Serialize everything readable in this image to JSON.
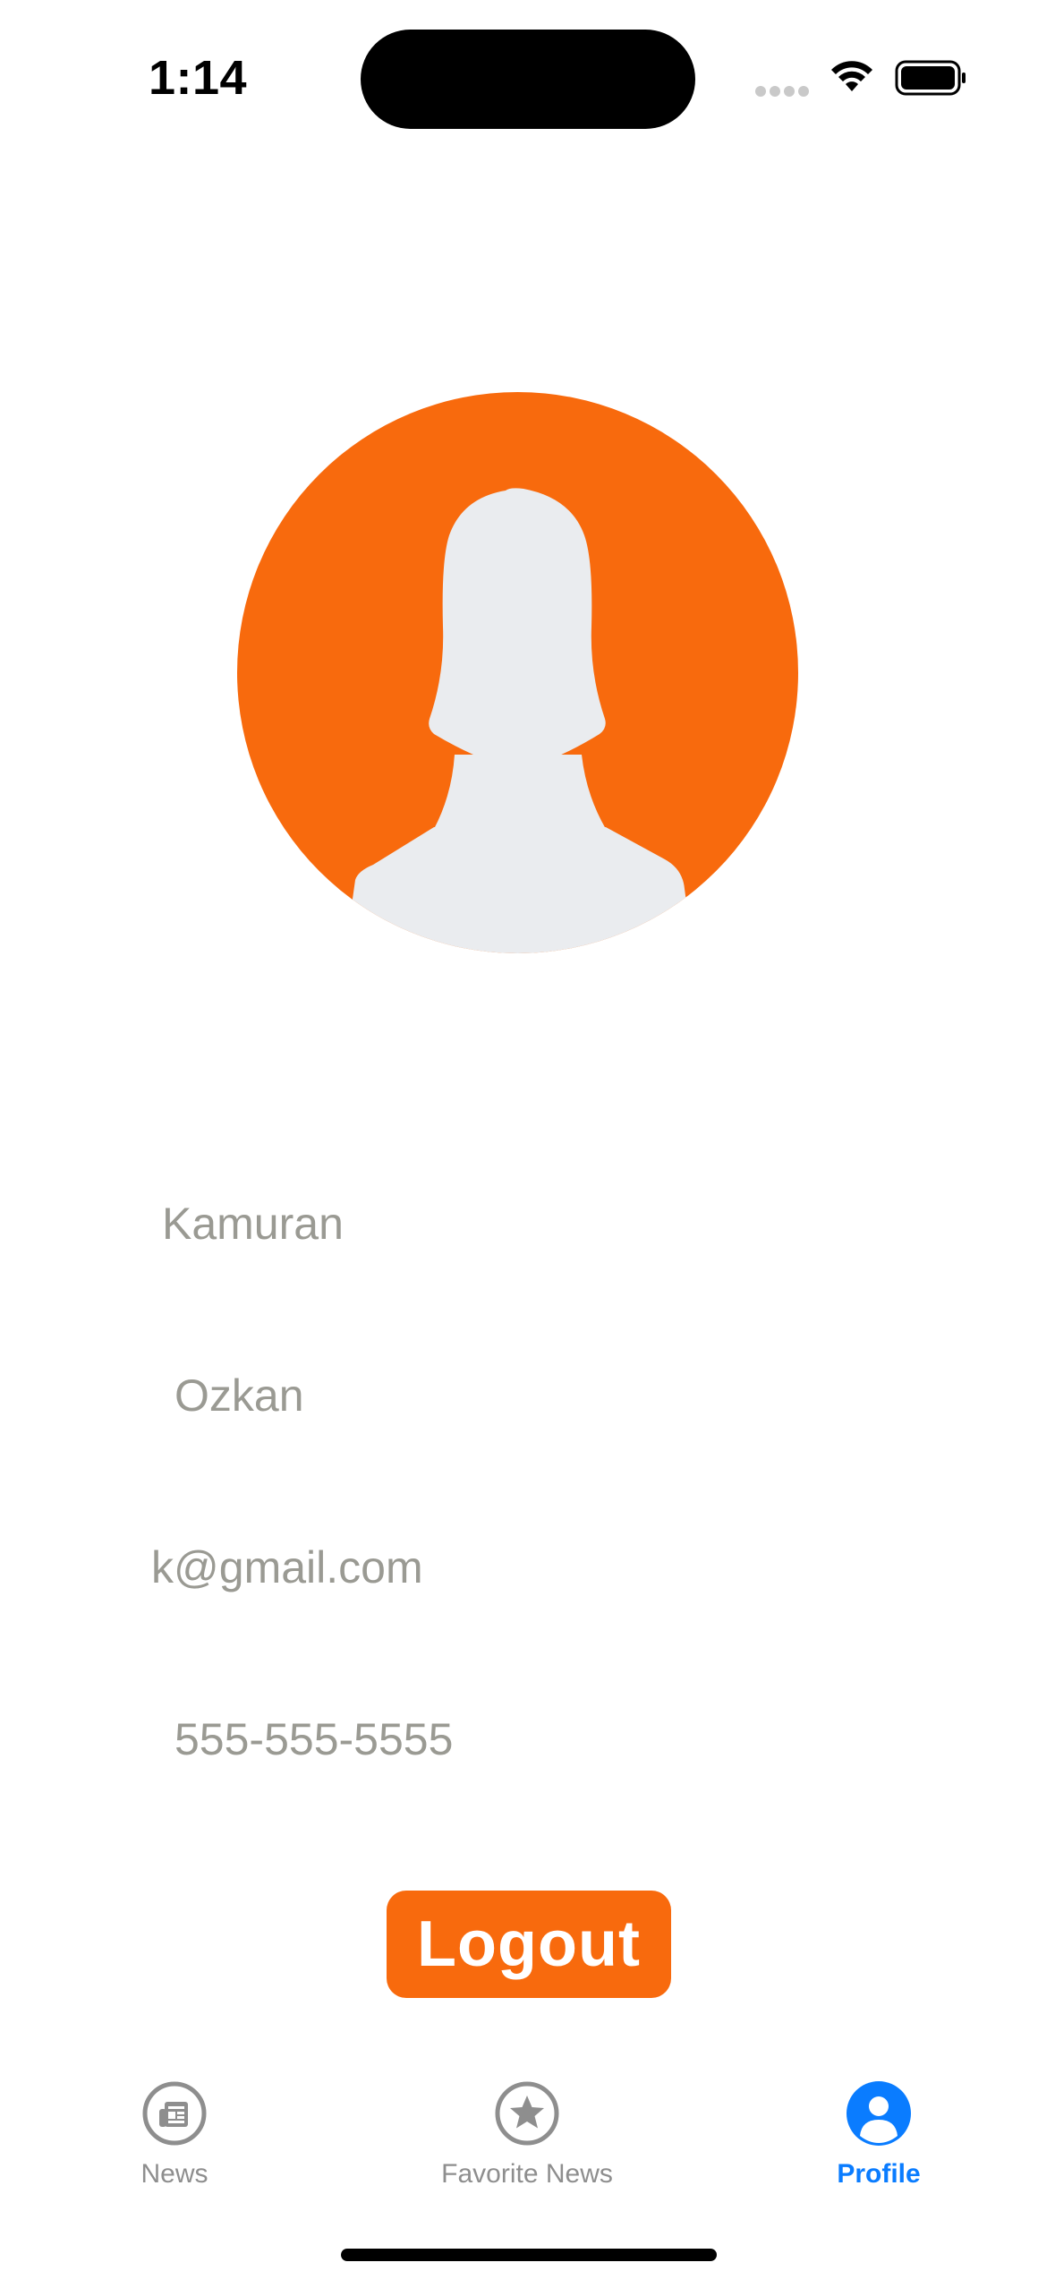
{
  "status_bar": {
    "time": "1:14"
  },
  "colors": {
    "accent": "#f86a0d",
    "avatar_silhouette": "#eaecef",
    "field_text": "#9a9a93",
    "tab_active": "#0a7cff",
    "tab_inactive": "#8e8e8e"
  },
  "profile": {
    "first_name": "Kamuran",
    "last_name": "Ozkan",
    "email": "k@gmail.com",
    "phone": "555-555-5555",
    "avatar_icon": "female-avatar-icon"
  },
  "actions": {
    "logout_label": "Logout"
  },
  "tab_bar": {
    "active": "profile",
    "items": [
      {
        "label": "News",
        "icon": "newspaper-icon"
      },
      {
        "label": "Favorite News",
        "icon": "star-circle-icon"
      },
      {
        "label": "Profile",
        "icon": "person-circle-icon"
      }
    ]
  }
}
